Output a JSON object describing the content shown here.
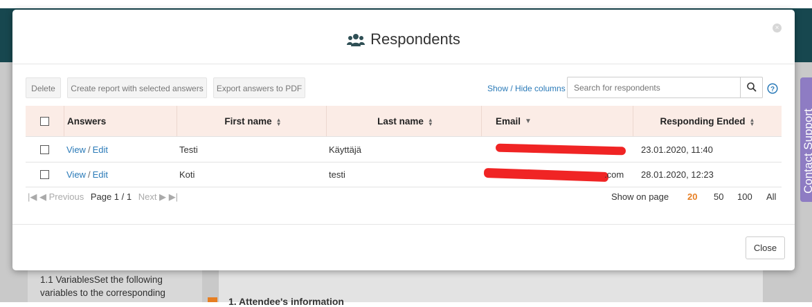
{
  "background": {
    "side_text": "1.1 VariablesSet the following variables to the corresponding",
    "section_heading": "1. Attendee's information",
    "contact_support": "Contact Support"
  },
  "modal": {
    "title": "Respondents",
    "title_icon": "users-icon",
    "close_icon": "×"
  },
  "toolbar": {
    "delete_label": "Delete",
    "create_report_label": "Create report with selected answers",
    "export_label": "Export answers to PDF",
    "show_hide_label": "Show / Hide columns",
    "search_placeholder": "Search for respondents",
    "search_value": "",
    "help_icon": "help-icon"
  },
  "table": {
    "headers": {
      "answers": "Answers",
      "first_name": "First name",
      "last_name": "Last name",
      "email": "Email",
      "responding_ended": "Responding Ended"
    },
    "rows": [
      {
        "view": "View",
        "sep": "/",
        "edit": "Edit",
        "first_name": "Testi",
        "last_name": "Käyttäjä",
        "email_visible": "",
        "responding_ended": "23.01.2020, 11:40"
      },
      {
        "view": "View",
        "sep": "/",
        "edit": "Edit",
        "first_name": "Koti",
        "last_name": "testi",
        "email_visible": ".com",
        "responding_ended": "28.01.2020, 12:23"
      }
    ]
  },
  "pager": {
    "first_icon": "|◀",
    "prev_label": "◀ Previous",
    "page_label": "Page 1 / 1",
    "next_label": "Next ▶",
    "last_icon": "▶|",
    "show_on_page": "Show on page",
    "options": [
      "20",
      "50",
      "100",
      "All"
    ],
    "selected": "20"
  },
  "footer": {
    "close_label": "Close"
  },
  "colors": {
    "accent": "#e67e22",
    "link": "#2a7ab8",
    "header_bg": "#fbece6",
    "topbar": "#17474f",
    "contact_tab": "#8e7cc3"
  }
}
